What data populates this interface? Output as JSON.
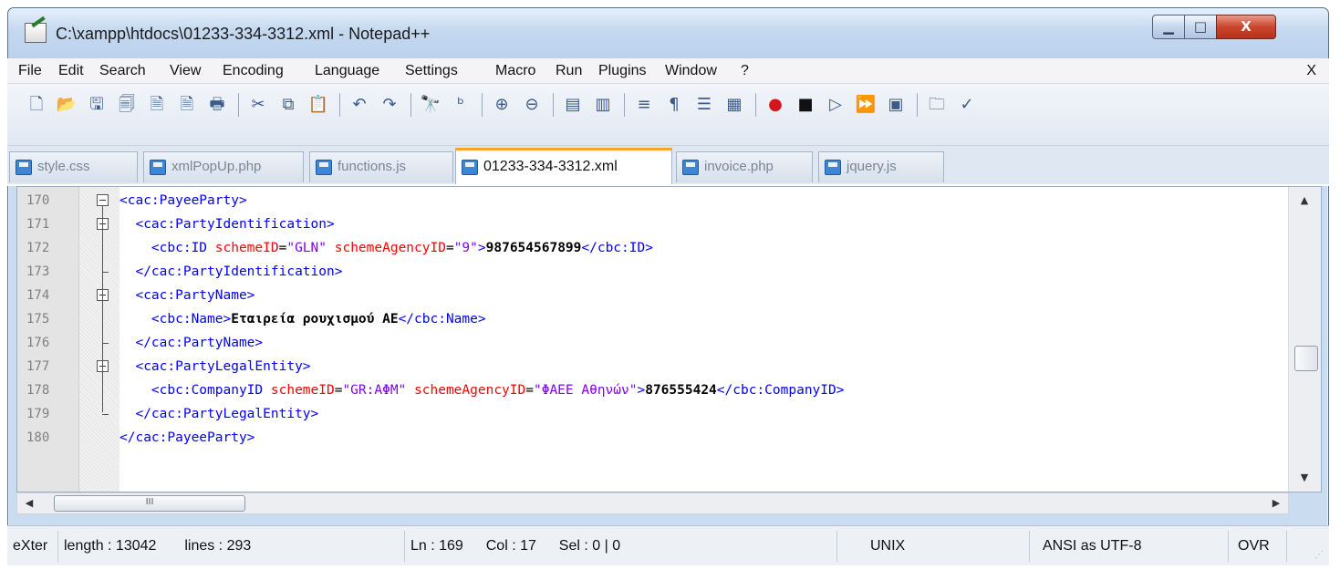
{
  "window": {
    "title": "C:\\xampp\\htdocs\\01233-334-3312.xml - Notepad++",
    "min_label": "▁",
    "max_label": "□",
    "close_label": "X"
  },
  "menu": {
    "items": [
      "File",
      "Edit",
      "Search",
      "View",
      "Encoding",
      "Language",
      "Settings",
      "Macro",
      "Run",
      "Plugins",
      "Window",
      "?"
    ],
    "close": "X"
  },
  "toolbar": {
    "icons": [
      "new-file-icon",
      "open-file-icon",
      "save-icon",
      "save-all-icon",
      "close-icon",
      "close-all-icon",
      "print-icon",
      "cut-icon",
      "copy-icon",
      "paste-icon",
      "undo-icon",
      "redo-icon",
      "find-icon",
      "replace-icon",
      "zoom-in-icon",
      "zoom-out-icon",
      "sync-vertical-icon",
      "sync-horizontal-icon",
      "word-wrap-icon",
      "show-all-chars-icon",
      "indent-guide-icon",
      "user-lang-icon",
      "record-macro-icon",
      "stop-macro-icon",
      "play-macro-icon",
      "run-macro-multiple-icon",
      "save-macro-icon",
      "folder-icon",
      "spellcheck-icon"
    ]
  },
  "tabs": [
    {
      "label": "style.css",
      "active": false
    },
    {
      "label": "xmlPopUp.php",
      "active": false
    },
    {
      "label": "functions.js",
      "active": false
    },
    {
      "label": "01233-334-3312.xml",
      "active": true
    },
    {
      "label": "invoice.php",
      "active": false
    },
    {
      "label": "jquery.js",
      "active": false
    }
  ],
  "editor": {
    "lines": [
      {
        "num": "170",
        "tokens": [
          {
            "t": "tag",
            "v": "<cac:PayeeParty>"
          }
        ]
      },
      {
        "num": "171",
        "tokens": [
          {
            "t": "sp",
            "v": "  "
          },
          {
            "t": "tag",
            "v": "<cac:PartyIdentification>"
          }
        ]
      },
      {
        "num": "172",
        "tokens": [
          {
            "t": "sp",
            "v": "    "
          },
          {
            "t": "tag",
            "v": "<cbc:ID "
          },
          {
            "t": "attr",
            "v": "schemeID"
          },
          {
            "t": "eq",
            "v": "="
          },
          {
            "t": "val",
            "v": "\"GLN\""
          },
          {
            "t": "sp",
            "v": " "
          },
          {
            "t": "attr",
            "v": "schemeAgencyID"
          },
          {
            "t": "eq",
            "v": "="
          },
          {
            "t": "val",
            "v": "\"9\""
          },
          {
            "t": "tag",
            "v": ">"
          },
          {
            "t": "text",
            "v": "987654567899"
          },
          {
            "t": "tag",
            "v": "</cbc:ID>"
          }
        ]
      },
      {
        "num": "173",
        "tokens": [
          {
            "t": "sp",
            "v": "  "
          },
          {
            "t": "tag",
            "v": "</cac:PartyIdentification>"
          }
        ]
      },
      {
        "num": "174",
        "tokens": [
          {
            "t": "sp",
            "v": "  "
          },
          {
            "t": "tag",
            "v": "<cac:PartyName>"
          }
        ]
      },
      {
        "num": "175",
        "tokens": [
          {
            "t": "sp",
            "v": "    "
          },
          {
            "t": "tag",
            "v": "<cbc:Name>"
          },
          {
            "t": "text",
            "v": "Εταιρεία ρουχισμού ΑΕ"
          },
          {
            "t": "tag",
            "v": "</cbc:Name>"
          }
        ]
      },
      {
        "num": "176",
        "tokens": [
          {
            "t": "sp",
            "v": "  "
          },
          {
            "t": "tag",
            "v": "</cac:PartyName>"
          }
        ]
      },
      {
        "num": "177",
        "tokens": [
          {
            "t": "sp",
            "v": "  "
          },
          {
            "t": "tag",
            "v": "<cac:PartyLegalEntity>"
          }
        ]
      },
      {
        "num": "178",
        "tokens": [
          {
            "t": "sp",
            "v": "    "
          },
          {
            "t": "tag",
            "v": "<cbc:CompanyID "
          },
          {
            "t": "attr",
            "v": "schemeID"
          },
          {
            "t": "eq",
            "v": "="
          },
          {
            "t": "val",
            "v": "\"GR:ΑΦΜ\""
          },
          {
            "t": "sp",
            "v": " "
          },
          {
            "t": "attr",
            "v": "schemeAgencyID"
          },
          {
            "t": "eq",
            "v": "="
          },
          {
            "t": "val",
            "v": "\"ΦΑΕΕ Αθηνών\""
          },
          {
            "t": "tag",
            "v": ">"
          },
          {
            "t": "text",
            "v": "876555424"
          },
          {
            "t": "tag",
            "v": "</cbc:CompanyID>"
          }
        ]
      },
      {
        "num": "179",
        "tokens": [
          {
            "t": "sp",
            "v": "  "
          },
          {
            "t": "tag",
            "v": "</cac:PartyLegalEntity>"
          }
        ]
      },
      {
        "num": "180",
        "tokens": [
          {
            "t": "tag",
            "v": "</cac:PayeeParty>"
          }
        ]
      }
    ],
    "hscroll_thumb_grip": "III"
  },
  "status": {
    "type": "eXter",
    "length": "length : 13042",
    "lines": "lines : 293",
    "ln": "Ln : 169",
    "col": "Col : 17",
    "sel": "Sel : 0 | 0",
    "eol": "UNIX",
    "encoding": "ANSI as UTF-8",
    "mode": "OVR"
  },
  "colors": {
    "tag": "#0000ff",
    "attr": "#ff0000",
    "value": "#8000ff",
    "text": "#000000",
    "active_tab_accent": "#f5a623"
  }
}
